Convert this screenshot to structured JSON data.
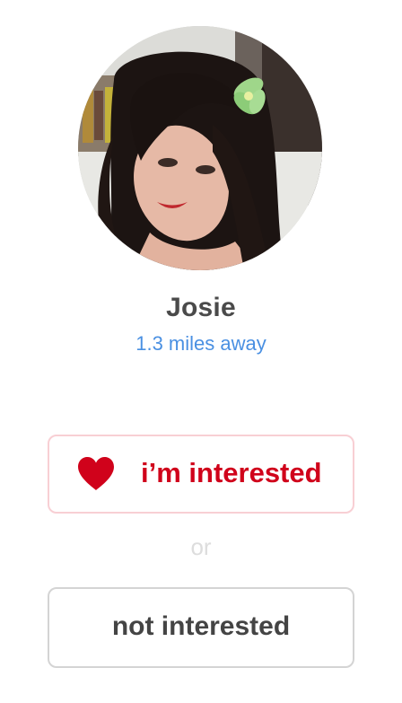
{
  "profile": {
    "name": "Josie",
    "distance": "1.3 miles away",
    "avatar_alt": ""
  },
  "actions": {
    "interested_label": "i’m interested",
    "interested_icon": "heart-icon",
    "separator": "or",
    "not_interested_label": "not interested"
  },
  "colors": {
    "accent_red": "#d0021b",
    "link_blue": "#4a90e2",
    "name_gray": "#4a4a4a",
    "interested_border": "#f8cfd4",
    "not_interested_border": "#d4d4d4",
    "separator_gray": "#dddddd"
  }
}
